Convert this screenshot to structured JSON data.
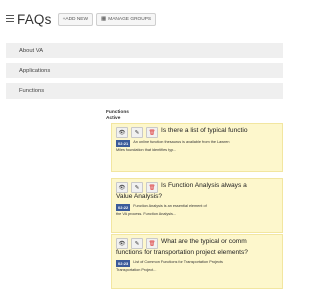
{
  "header": {
    "title": "FAQs",
    "add_new_label": "+ADD NEW",
    "manage_groups_label": "MANAGE GROUPS"
  },
  "groups": [
    {
      "label": "About VA"
    },
    {
      "label": "Applications"
    },
    {
      "label": "Functions"
    }
  ],
  "panel": {
    "title": "Functions",
    "status": "Active"
  },
  "faqs": [
    {
      "question": "Is there a list of typical functio",
      "question_cont": "",
      "tag": "02:21",
      "answer_line1": "An online function thesaurus is available from the Lawren",
      "answer_line2": "Miles foundation that identifies typ..."
    },
    {
      "question": "Is Function Analysis always a",
      "question_cont": "Value Analysis?",
      "tag": "02:22",
      "answer_line1": "Function Analysis is an essential element of",
      "answer_line2": "the VA process. Function Analysis..."
    },
    {
      "question": "What are the typical or comm",
      "question_cont": "functions for transportation project elements?",
      "tag": "02:23",
      "answer_line1": "List of Common Functions for Transportation Projects",
      "answer_line2": "Transportation Project..."
    }
  ]
}
